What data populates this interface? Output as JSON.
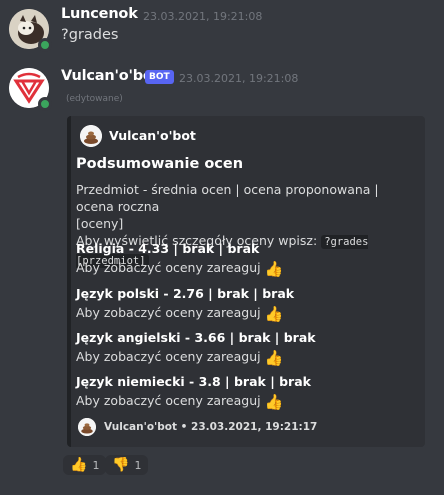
{
  "messages": [
    {
      "username": "Luncenok",
      "timestamp": "23.03.2021, 19:21:08",
      "content": "?grades"
    },
    {
      "username": "Vulcan'o'bot",
      "bot_tag": "BOT",
      "timestamp": "23.03.2021, 19:21:08",
      "edited": "(edytowane)"
    }
  ],
  "embed": {
    "author": "Vulcan'o'bot",
    "title": "Podsumowanie ocen",
    "description_line1": "Przedmiot - średnia ocen | ocena proponowana | ocena roczna",
    "description_line2": "[oceny]",
    "description_line3_prefix": "Aby wyświetlić szczegóły oceny wpisz:",
    "description_code": "?grades [przedmiot]",
    "fields": [
      {
        "name": "Religia - 4.33 | brak | brak",
        "value": "Aby zobaczyć oceny zareaguj"
      },
      {
        "name": "Język polski - 2.76 | brak | brak",
        "value": "Aby zobaczyć oceny zareaguj"
      },
      {
        "name": "Język angielski - 3.66 | brak | brak",
        "value": "Aby zobaczyć oceny zareaguj"
      },
      {
        "name": "Język niemiecki - 3.8 | brak | brak",
        "value": "Aby zobaczyć oceny zareaguj"
      }
    ],
    "footer": "Vulcan'o'bot • 23.03.2021, 19:21:17"
  },
  "reactions": [
    {
      "emoji": "thumbs-up",
      "count": "1"
    },
    {
      "emoji": "thumbs-down",
      "count": "1"
    }
  ],
  "colors": {
    "background": "#36393f",
    "embed_bg": "#2f3136",
    "online": "#3ba55d",
    "bot_tag": "#5865f2",
    "bot_logo": "#e0313b"
  }
}
